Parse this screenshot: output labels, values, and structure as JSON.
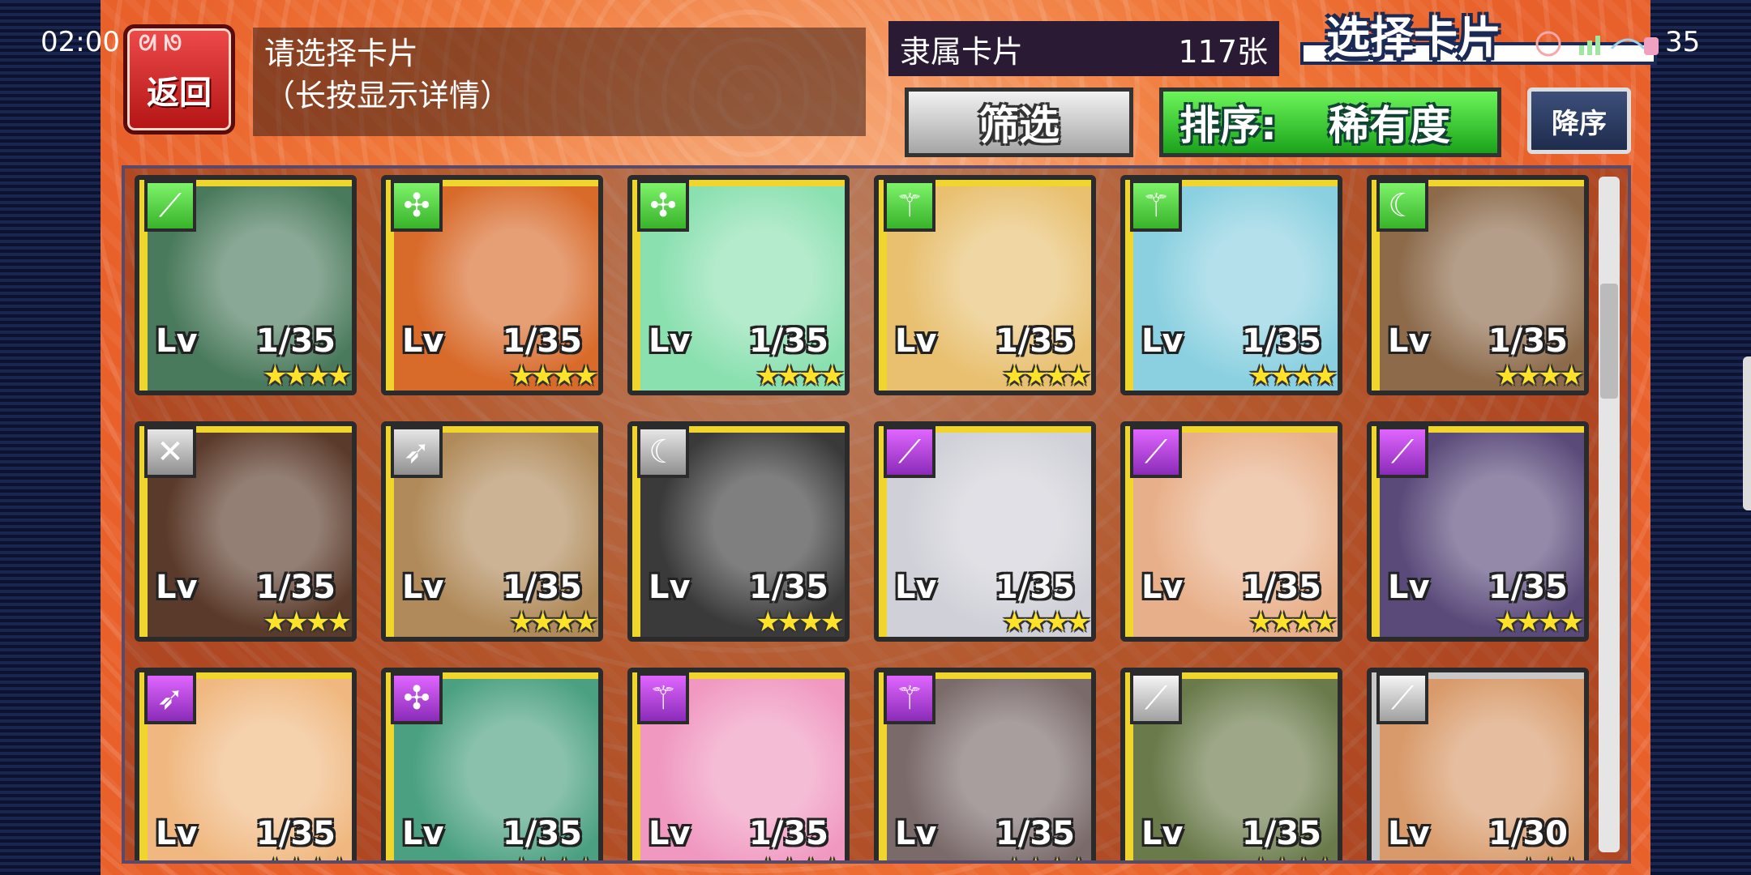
{
  "status_bar": {
    "time": "02:00",
    "battery": "35"
  },
  "back_button": {
    "label": "返回"
  },
  "prompt": {
    "line1": "请选择卡片",
    "line2": "（长按显示详情）"
  },
  "owned": {
    "label": "隶属卡片",
    "count": "117张"
  },
  "title": "选择卡片",
  "filter_button": {
    "label": "筛选"
  },
  "sort_button": {
    "label": "排序:",
    "value": "稀有度"
  },
  "order_button": {
    "label": "降序"
  },
  "colors": {
    "game_bg": "#f07a3b",
    "card_gold": "#f0d62c",
    "sort_green": "#37b32a",
    "tag_purple": "#a83ad4",
    "back_red": "#c81e1e"
  },
  "cards": [
    {
      "lv_label": "Lv",
      "level": "1/35",
      "stars": "★★★★",
      "tag_icon": "spear-icon",
      "tag_color": "green",
      "frame": "gold",
      "bg": "#4a7a5c"
    },
    {
      "lv_label": "Lv",
      "level": "1/35",
      "stars": "★★★★",
      "tag_icon": "mace-icon",
      "tag_color": "green",
      "frame": "gold",
      "bg": "#d86a2a"
    },
    {
      "lv_label": "Lv",
      "level": "1/35",
      "stars": "★★★★",
      "tag_icon": "mace-icon",
      "tag_color": "green",
      "frame": "gold",
      "bg": "#8be0b0"
    },
    {
      "lv_label": "Lv",
      "level": "1/35",
      "stars": "★★★★",
      "tag_icon": "staff-icon",
      "tag_color": "green",
      "frame": "gold",
      "bg": "#e8c070"
    },
    {
      "lv_label": "Lv",
      "level": "1/35",
      "stars": "★★★★",
      "tag_icon": "staff-icon",
      "tag_color": "green",
      "frame": "gold",
      "bg": "#8ad0e0"
    },
    {
      "lv_label": "Lv",
      "level": "1/35",
      "stars": "★★★★",
      "tag_icon": "claw-icon",
      "tag_color": "green",
      "frame": "gold",
      "bg": "#8c6a4a"
    },
    {
      "lv_label": "Lv",
      "level": "1/35",
      "stars": "★★★★",
      "tag_icon": "fists-icon",
      "tag_color": "gray",
      "frame": "gold",
      "bg": "#5a3a2a"
    },
    {
      "lv_label": "Lv",
      "level": "1/35",
      "stars": "★★★★",
      "tag_icon": "bow-icon",
      "tag_color": "gray",
      "frame": "gold",
      "bg": "#b08a5a"
    },
    {
      "lv_label": "Lv",
      "level": "1/35",
      "stars": "★★★★",
      "tag_icon": "claw-icon",
      "tag_color": "gray",
      "frame": "gold",
      "bg": "#3a3a3a"
    },
    {
      "lv_label": "Lv",
      "level": "1/35",
      "stars": "★★★★",
      "tag_icon": "spear-icon",
      "tag_color": "purple",
      "frame": "gold",
      "bg": "#d0d0d8"
    },
    {
      "lv_label": "Lv",
      "level": "1/35",
      "stars": "★★★★",
      "tag_icon": "spear-icon",
      "tag_color": "purple",
      "frame": "gold",
      "bg": "#e8b08a"
    },
    {
      "lv_label": "Lv",
      "level": "1/35",
      "stars": "★★★★",
      "tag_icon": "spear-icon",
      "tag_color": "purple",
      "frame": "gold",
      "bg": "#5a4a7a"
    },
    {
      "lv_label": "Lv",
      "level": "1/35",
      "stars": "★★★★",
      "tag_icon": "bow-icon",
      "tag_color": "purple",
      "frame": "gold",
      "bg": "#f0b880"
    },
    {
      "lv_label": "Lv",
      "level": "1/35",
      "stars": "★★★★",
      "tag_icon": "mace-icon",
      "tag_color": "purple",
      "frame": "gold",
      "bg": "#4aa080"
    },
    {
      "lv_label": "Lv",
      "level": "1/35",
      "stars": "★★★★",
      "tag_icon": "staff-icon",
      "tag_color": "purple",
      "frame": "gold",
      "bg": "#f098c0"
    },
    {
      "lv_label": "Lv",
      "level": "1/35",
      "stars": "★★★★",
      "tag_icon": "staff-icon",
      "tag_color": "purple",
      "frame": "gold",
      "bg": "#7a6a6a"
    },
    {
      "lv_label": "Lv",
      "level": "1/35",
      "stars": "★★★★",
      "tag_icon": "spear-icon",
      "tag_color": "silver",
      "frame": "gold",
      "bg": "#6a7a4a"
    },
    {
      "lv_label": "Lv",
      "level": "1/30",
      "stars": "★★★",
      "tag_icon": "spear-icon",
      "tag_color": "silver",
      "frame": "silver",
      "bg": "#d89a6a"
    }
  ]
}
